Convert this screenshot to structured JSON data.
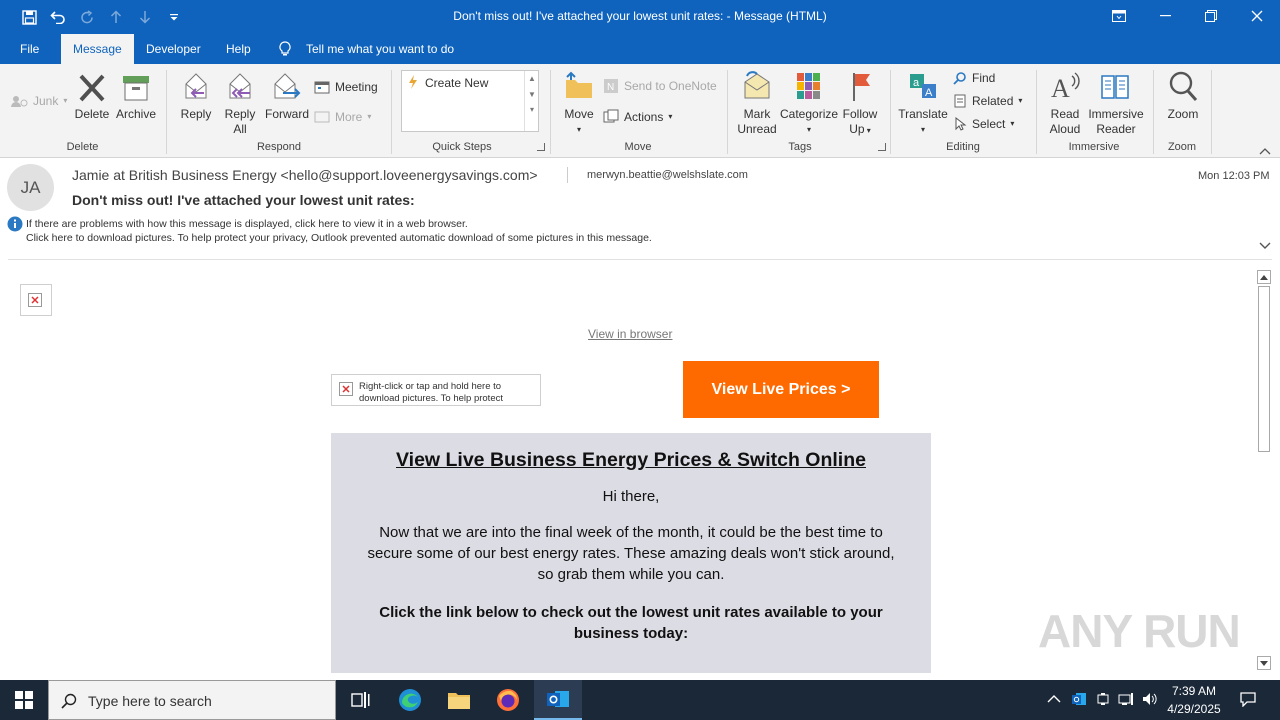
{
  "window": {
    "title": "Don't miss out! I've attached your lowest unit rates:  -  Message (HTML)"
  },
  "menu": {
    "tabs": [
      "File",
      "Message",
      "Developer",
      "Help"
    ],
    "active_tab": "Message",
    "tell_me": "Tell me what you want to do"
  },
  "ribbon": {
    "junk": "Junk",
    "delete": "Delete",
    "archive": "Archive",
    "reply": "Reply",
    "reply_all_1": "Reply",
    "reply_all_2": "All",
    "forward": "Forward",
    "meeting": "Meeting",
    "more": "More",
    "create_new": "Create New",
    "move": "Move",
    "send_onenote": "Send to OneNote",
    "actions": "Actions",
    "mark_unread_1": "Mark",
    "mark_unread_2": "Unread",
    "categorize": "Categorize",
    "follow_up_1": "Follow",
    "follow_up_2": "Up",
    "translate": "Translate",
    "find": "Find",
    "related": "Related",
    "select": "Select",
    "read_aloud_1": "Read",
    "read_aloud_2": "Aloud",
    "immersive_1": "Immersive",
    "immersive_2": "Reader",
    "zoom": "Zoom",
    "groups": {
      "delete": "Delete",
      "respond": "Respond",
      "quick_steps": "Quick Steps",
      "move": "Move",
      "tags": "Tags",
      "editing": "Editing",
      "immersive": "Immersive",
      "zoom": "Zoom"
    }
  },
  "message": {
    "avatar_initials": "JA",
    "from": "Jamie at British Business Energy <hello@support.loveenergysavings.com>",
    "to": "merwyn.beattie@welshslate.com",
    "date": "Mon 12:03 PM",
    "subject": "Don't miss out! I've attached your lowest unit rates:",
    "info_line_1": "If there are problems with how this message is displayed, click here to view it in a web browser.",
    "info_line_2": "Click here to download pictures. To help protect your privacy, Outlook prevented automatic download of some pictures in this message."
  },
  "email_body": {
    "view_in_browser": "View in browser",
    "image_placeholder_1": "Right-click or tap and hold here to",
    "image_placeholder_2": "download pictures. To help protect",
    "cta_button": "View Live Prices >",
    "heading": "View Live Business Energy Prices & Switch Online",
    "greeting": "Hi there,",
    "paragraph": "Now that we are into the final week of the month, it could be the best time to secure some of our best energy rates. These amazing deals won't stick around, so grab them while you can.",
    "bold_paragraph": "Click the link below to check out the lowest unit rates available to your business today:"
  },
  "watermark": "ANY RUN",
  "taskbar": {
    "search_placeholder": "Type here to search",
    "time": "7:39 AM",
    "date": "4/29/2025"
  },
  "colors": {
    "brand_blue": "#0f63bd",
    "cta_orange": "#ff6a00",
    "email_panel": "#dcdce4",
    "taskbar": "#1b2838"
  }
}
